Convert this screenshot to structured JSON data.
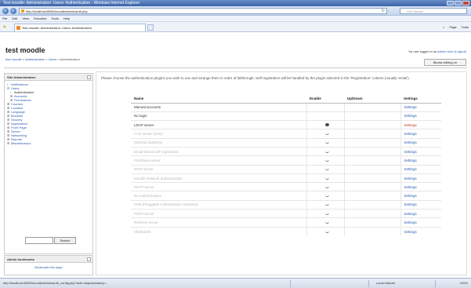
{
  "window": {
    "title": "Test moodle: Administration: Users: Authentication - Windows Internet Explorer"
  },
  "browser": {
    "url": "http://localhost:8080/moodle/admin/auth.php",
    "search_placeholder": "Live Search",
    "menu": [
      "File",
      "Edit",
      "View",
      "Favorites",
      "Tools",
      "Help"
    ],
    "tab_label": "Test moodle: Administration: Users: Authentication",
    "tools": [
      "Page",
      "Tools"
    ]
  },
  "site": {
    "title": "test moodle",
    "login_prefix": "You are logged in as",
    "login_user": "Admin User (Logout)",
    "breadcrumb": [
      "test moodle",
      "Administration",
      "Users",
      "Authentication"
    ],
    "blocks_button": "Blocks editing on"
  },
  "admin_block": {
    "title": "Site Administration",
    "items": [
      {
        "label": "Notifications",
        "level": 0,
        "sym": "•"
      },
      {
        "label": "Users",
        "level": 0,
        "sym": "⊟"
      },
      {
        "label": "Authentication",
        "level": 1,
        "sym": "•"
      },
      {
        "label": "Accounts",
        "level": 1,
        "sym": "⊞"
      },
      {
        "label": "Permissions",
        "level": 1,
        "sym": "⊞"
      },
      {
        "label": "Courses",
        "level": 0,
        "sym": "⊞"
      },
      {
        "label": "Location",
        "level": 0,
        "sym": "⊞"
      },
      {
        "label": "Language",
        "level": 0,
        "sym": "⊞"
      },
      {
        "label": "Modules",
        "level": 0,
        "sym": "⊞"
      },
      {
        "label": "Security",
        "level": 0,
        "sym": "⊞"
      },
      {
        "label": "Appearance",
        "level": 0,
        "sym": "⊞"
      },
      {
        "label": "Front Page",
        "level": 0,
        "sym": "⊞"
      },
      {
        "label": "Server",
        "level": 0,
        "sym": "⊞"
      },
      {
        "label": "Networking",
        "level": 0,
        "sym": "⊞"
      },
      {
        "label": "Reports",
        "level": 0,
        "sym": "⊞"
      },
      {
        "label": "Miscellaneous",
        "level": 0,
        "sym": "⊞"
      }
    ],
    "search_button": "Search"
  },
  "bookmarks_block": {
    "title": "Admin bookmarks",
    "link": "Bookmark this page"
  },
  "main": {
    "instructions": "Please choose the authentication plugins you wish to use and arrange them in order of failthrough. Self registration will be handled by the plugin selected in the \"Registration\" column (usually 'email').",
    "columns": [
      "Name",
      "Enable",
      "Up/Down",
      "Settings"
    ],
    "rows": [
      {
        "name": "Manual accounts",
        "enabled": true,
        "icon": "",
        "settings": "Settings"
      },
      {
        "name": "No login",
        "enabled": true,
        "icon": "",
        "settings": "Settings"
      },
      {
        "name": "LDAP server",
        "enabled": true,
        "icon": "eye-icon",
        "settings": "Settings"
      },
      {
        "name": "CAS server (SSO)",
        "enabled": false,
        "icon": "chevron-icon",
        "settings": "Settings"
      },
      {
        "name": "External database",
        "enabled": false,
        "icon": "chevron-icon",
        "settings": "Settings"
      },
      {
        "name": "Email-based self-registration",
        "enabled": false,
        "icon": "chevron-icon",
        "settings": "Settings"
      },
      {
        "name": "FirstClass server",
        "enabled": false,
        "icon": "chevron-icon",
        "settings": "Settings"
      },
      {
        "name": "IMAP server",
        "enabled": false,
        "icon": "chevron-icon",
        "settings": "Settings"
      },
      {
        "name": "Moodle Network authentication",
        "enabled": false,
        "icon": "chevron-icon",
        "settings": "Settings"
      },
      {
        "name": "NNTP server",
        "enabled": false,
        "icon": "chevron-icon",
        "settings": "Settings"
      },
      {
        "name": "No authentication",
        "enabled": false,
        "icon": "chevron-icon",
        "settings": "Settings"
      },
      {
        "name": "PAM (Pluggable Authentication Modules)",
        "enabled": false,
        "icon": "chevron-icon",
        "settings": "Settings"
      },
      {
        "name": "POP3 server",
        "enabled": false,
        "icon": "chevron-icon",
        "settings": "Settings"
      },
      {
        "name": "RADIUS server",
        "enabled": false,
        "icon": "chevron-icon",
        "settings": "Settings"
      },
      {
        "name": "Shibboleth",
        "enabled": false,
        "icon": "chevron-icon",
        "settings": "Settings"
      }
    ]
  },
  "status": {
    "url": "http://localhost:8080/moodle/admin/auth_config.php?auth=ldap&sesskey=...",
    "zone": "Local intranet",
    "zoom": "100%"
  },
  "colors": {
    "link": "#2a5db0",
    "hot_link": "#c0392b",
    "titlebar": "#3a63a8"
  }
}
